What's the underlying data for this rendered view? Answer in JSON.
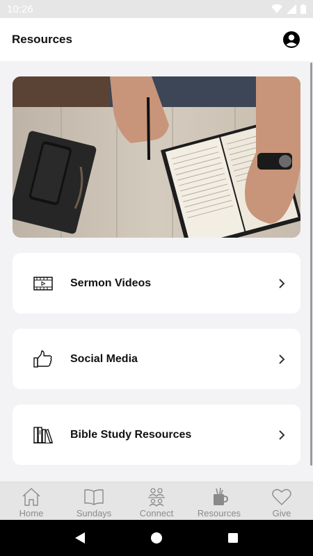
{
  "status_bar": {
    "time": "10:26"
  },
  "header": {
    "title": "Resources",
    "profile_icon": "account-circle-icon"
  },
  "hero": {
    "image": "photo-bible-notebook-phone"
  },
  "cards": [
    {
      "label": "Sermon Videos",
      "icon": "film-strip-icon"
    },
    {
      "label": "Social Media",
      "icon": "thumbs-up-icon"
    },
    {
      "label": "Bible Study Resources",
      "icon": "books-icon"
    }
  ],
  "tabs": [
    {
      "label": "Home",
      "icon": "home-icon"
    },
    {
      "label": "Sundays",
      "icon": "open-book-icon"
    },
    {
      "label": "Connect",
      "icon": "people-icon"
    },
    {
      "label": "Resources",
      "icon": "cup-icon"
    },
    {
      "label": "Give",
      "icon": "heart-icon"
    }
  ],
  "colors": {
    "background": "#f3f3f6",
    "card": "#ffffff",
    "tab_bar": "#e5e5e5",
    "tab_label": "#8a8a8a"
  }
}
